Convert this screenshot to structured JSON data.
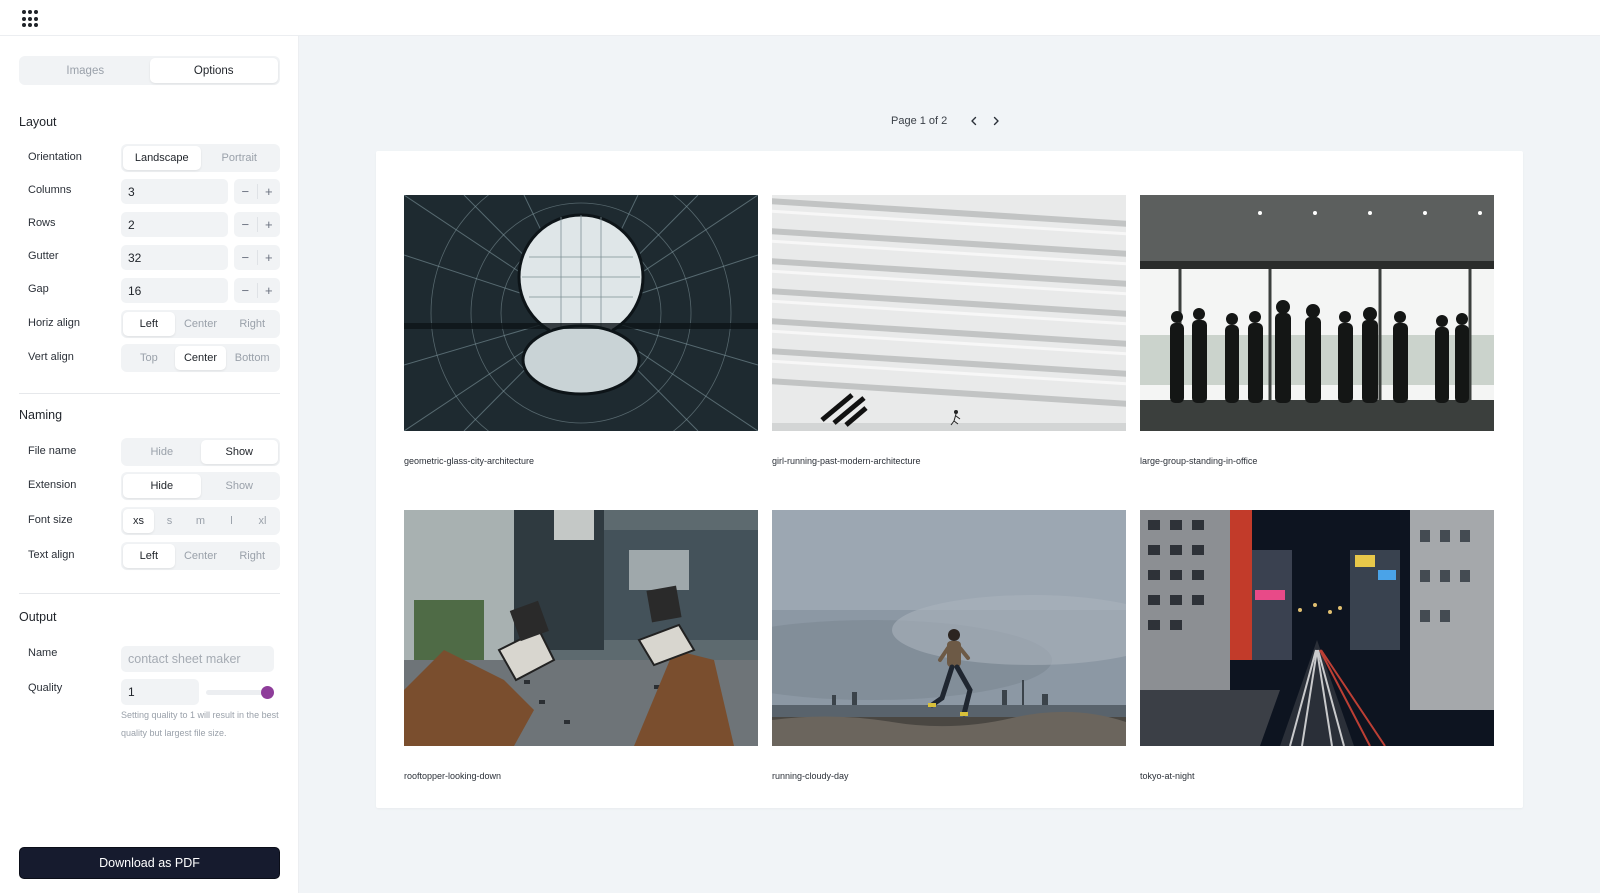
{
  "tabs": [
    {
      "label": "Images",
      "active": false
    },
    {
      "label": "Options",
      "active": true
    }
  ],
  "layout": {
    "title": "Layout",
    "orientation": {
      "label": "Orientation",
      "options": [
        "Landscape",
        "Portrait"
      ],
      "selected": "Landscape"
    },
    "columns": {
      "label": "Columns",
      "value": "3"
    },
    "rows": {
      "label": "Rows",
      "value": "2"
    },
    "gutter": {
      "label": "Gutter",
      "value": "32"
    },
    "gap": {
      "label": "Gap",
      "value": "16"
    },
    "horiz_align": {
      "label": "Horiz align",
      "options": [
        "Left",
        "Center",
        "Right"
      ],
      "selected": "Left"
    },
    "vert_align": {
      "label": "Vert align",
      "options": [
        "Top",
        "Center",
        "Bottom"
      ],
      "selected": "Center"
    }
  },
  "stepper": {
    "minus": "−",
    "plus": "+"
  },
  "naming": {
    "title": "Naming",
    "file_name": {
      "label": "File name",
      "options": [
        "Hide",
        "Show"
      ],
      "selected": "Show"
    },
    "extension": {
      "label": "Extension",
      "options": [
        "Hide",
        "Show"
      ],
      "selected": "Hide"
    },
    "font_size": {
      "label": "Font size",
      "options": [
        "xs",
        "s",
        "m",
        "l",
        "xl"
      ],
      "selected": "xs"
    },
    "text_align": {
      "label": "Text align",
      "options": [
        "Left",
        "Center",
        "Right"
      ],
      "selected": "Left"
    }
  },
  "output": {
    "title": "Output",
    "name": {
      "label": "Name",
      "placeholder": "contact sheet maker"
    },
    "quality": {
      "label": "Quality",
      "value": "1",
      "slider_level": 1.0,
      "help": "Setting quality to 1 will result in the best quality but largest file size."
    }
  },
  "download_label": "Download as PDF",
  "pager": {
    "text": "Page 1 of 2"
  },
  "images": [
    {
      "caption": "geometric-glass-city-architecture",
      "icon": "glass-dome-photo"
    },
    {
      "caption": "girl-running-past-modern-architecture",
      "icon": "white-facade-photo"
    },
    {
      "caption": "large-group-standing-in-office",
      "icon": "silhouettes-photo"
    },
    {
      "caption": "rooftopper-looking-down",
      "icon": "rooftop-photo"
    },
    {
      "caption": "running-cloudy-day",
      "icon": "runner-photo"
    },
    {
      "caption": "tokyo-at-night",
      "icon": "city-night-photo"
    }
  ],
  "colors": {
    "accent": "#8e3d9a",
    "primary_button": "#161b2e",
    "canvas": "#f1f4f7"
  }
}
